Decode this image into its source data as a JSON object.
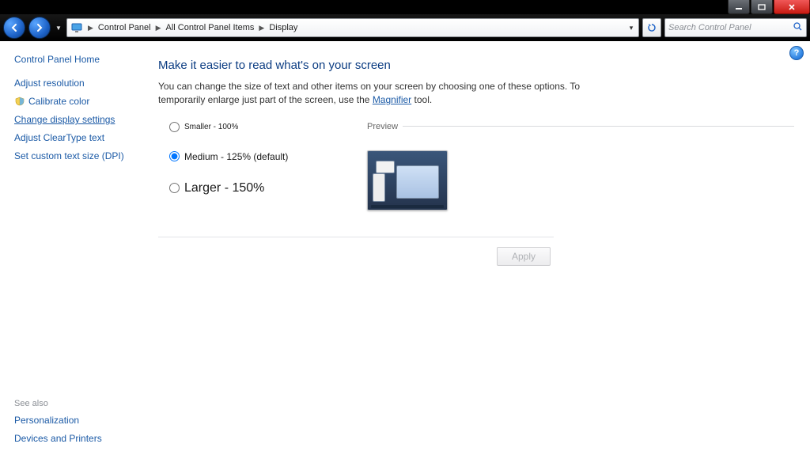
{
  "titlebar": {
    "min": "_",
    "max": "▢",
    "close": "✕"
  },
  "nav": {
    "breadcrumbs": [
      "Control Panel",
      "All Control Panel Items",
      "Display"
    ],
    "search_placeholder": "Search Control Panel"
  },
  "sidebar": {
    "home": "Control Panel Home",
    "links": [
      {
        "label": "Adjust resolution",
        "icon": null,
        "active": false
      },
      {
        "label": "Calibrate color",
        "icon": "shield",
        "active": false
      },
      {
        "label": "Change display settings",
        "icon": null,
        "active": true
      },
      {
        "label": "Adjust ClearType text",
        "icon": null,
        "active": false
      },
      {
        "label": "Set custom text size (DPI)",
        "icon": null,
        "active": false
      }
    ],
    "seealso_header": "See also",
    "seealso": [
      "Personalization",
      "Devices and Printers"
    ]
  },
  "content": {
    "heading": "Make it easier to read what's on your screen",
    "desc_before": "You can change the size of text and other items on your screen by choosing one of these options. To temporarily enlarge just part of the screen, use the ",
    "desc_link": "Magnifier",
    "desc_after": " tool.",
    "options": [
      {
        "label": "Smaller - 100%",
        "size": "small",
        "selected": false
      },
      {
        "label": "Medium - 125% (default)",
        "size": "medium",
        "selected": true
      },
      {
        "label": "Larger - 150%",
        "size": "larger",
        "selected": false
      }
    ],
    "preview_label": "Preview",
    "apply_label": "Apply"
  },
  "help": "?"
}
